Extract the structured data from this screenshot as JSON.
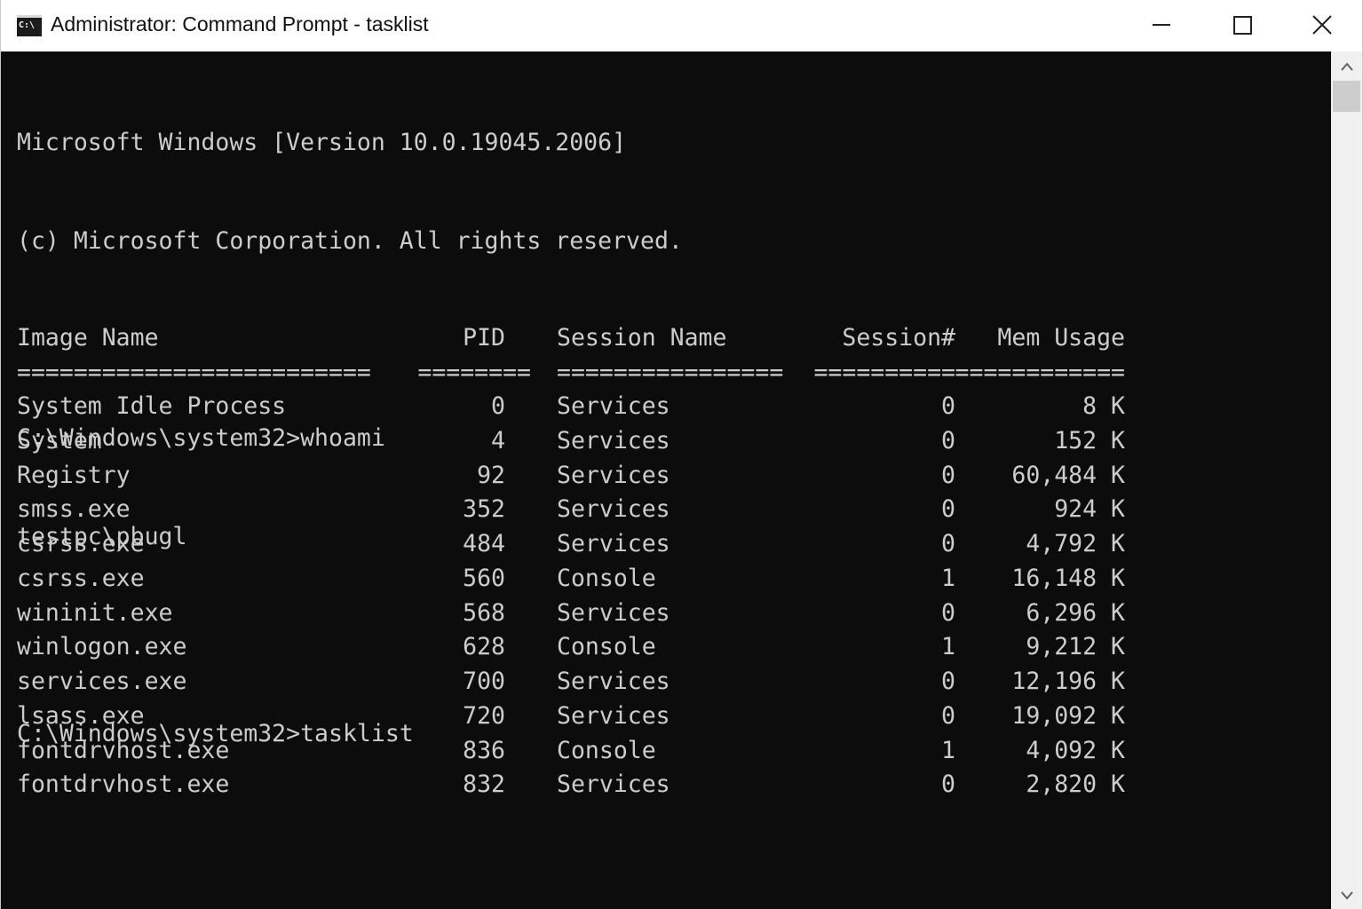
{
  "window": {
    "title": "Administrator: Command Prompt - tasklist",
    "icon": "cmd-icon",
    "icon_text": "C:\\"
  },
  "console": {
    "lines": [
      "Microsoft Windows [Version 10.0.19045.2006]",
      "(c) Microsoft Corporation. All rights reserved.",
      "",
      "C:\\Windows\\system32>whoami",
      "testpc\\pbugl",
      "",
      "C:\\Windows\\system32>tasklist"
    ],
    "table": {
      "headers": {
        "image_name": "Image Name",
        "pid": "PID",
        "session_name": "Session Name",
        "session_num": "Session#",
        "mem_usage": "Mem Usage"
      },
      "separators": {
        "image_name": "=========================",
        "pid": "========",
        "session_name": "================",
        "session_num": "==========",
        "mem_usage": "============"
      },
      "rows": [
        {
          "name": "System Idle Process",
          "pid": "0",
          "session": "Services",
          "num": "0",
          "mem": "8 K"
        },
        {
          "name": "System",
          "pid": "4",
          "session": "Services",
          "num": "0",
          "mem": "152 K"
        },
        {
          "name": "Registry",
          "pid": "92",
          "session": "Services",
          "num": "0",
          "mem": "60,484 K"
        },
        {
          "name": "smss.exe",
          "pid": "352",
          "session": "Services",
          "num": "0",
          "mem": "924 K"
        },
        {
          "name": "csrss.exe",
          "pid": "484",
          "session": "Services",
          "num": "0",
          "mem": "4,792 K"
        },
        {
          "name": "csrss.exe",
          "pid": "560",
          "session": "Console",
          "num": "1",
          "mem": "16,148 K"
        },
        {
          "name": "wininit.exe",
          "pid": "568",
          "session": "Services",
          "num": "0",
          "mem": "6,296 K"
        },
        {
          "name": "winlogon.exe",
          "pid": "628",
          "session": "Console",
          "num": "1",
          "mem": "9,212 K"
        },
        {
          "name": "services.exe",
          "pid": "700",
          "session": "Services",
          "num": "0",
          "mem": "12,196 K"
        },
        {
          "name": "lsass.exe",
          "pid": "720",
          "session": "Services",
          "num": "0",
          "mem": "19,092 K"
        },
        {
          "name": "fontdrvhost.exe",
          "pid": "836",
          "session": "Console",
          "num": "1",
          "mem": "4,092 K"
        },
        {
          "name": "fontdrvhost.exe",
          "pid": "832",
          "session": "Services",
          "num": "0",
          "mem": "2,820 K"
        }
      ]
    }
  },
  "colors": {
    "console_background": "#0c0c0c",
    "console_text": "#cccccc",
    "titlebar_background": "#ffffff"
  }
}
